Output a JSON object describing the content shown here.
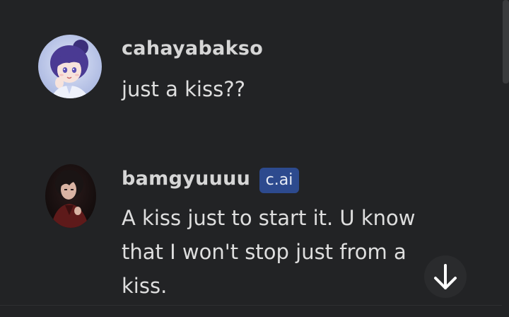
{
  "messages": [
    {
      "username": "cahayabakso",
      "text": "just a kiss??",
      "avatar_icon": "anime-girl-avatar-icon"
    },
    {
      "username": "bamgyuuuu",
      "badge": "c.ai",
      "text": "A kiss just to start it. U know that I won't stop just from a kiss.",
      "avatar_icon": "character-avatar-icon"
    }
  ],
  "scroll_button": {
    "icon": "arrow-down-icon"
  },
  "colors": {
    "background": "#222325",
    "badge": "#2d4a8e",
    "username": "#d6d6d6",
    "text": "#dedede"
  }
}
